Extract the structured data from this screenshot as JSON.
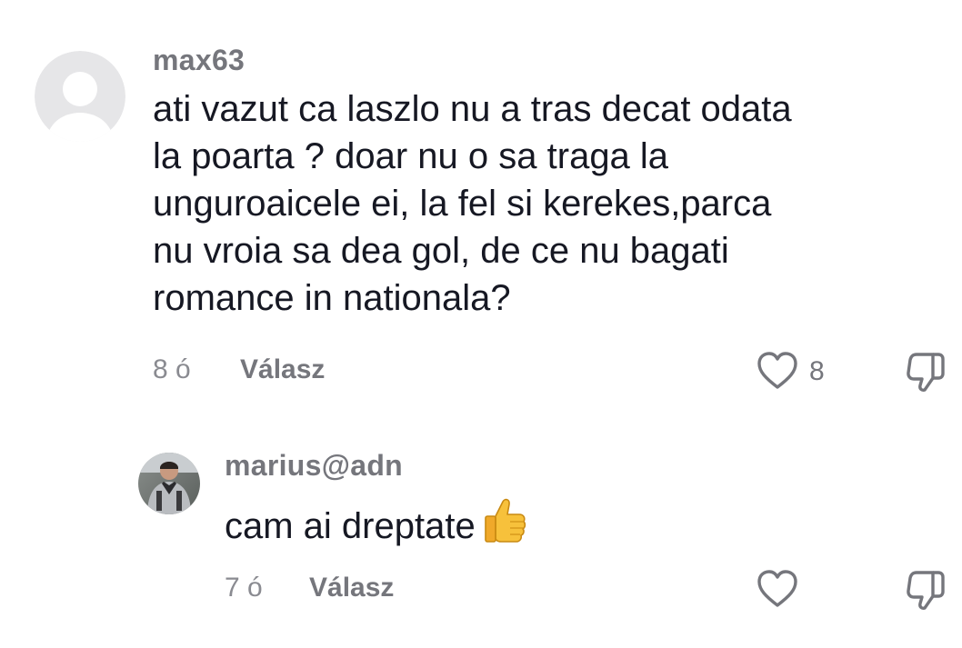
{
  "comments": [
    {
      "username": "max63",
      "text": "ati vazut ca laszlo nu a tras decat odata la poarta ? doar nu o sa traga la unguroaicele ei, la fel si kerekes,parca nu vroia sa dea gol, de ce nu bagati romance in nationala?",
      "lines": [
        "ati vazut ca laszlo nu a tras decat odata",
        "la poarta ? doar nu o sa traga la",
        "unguroaicele ei, la fel si kerekes,parca",
        "nu vroia sa dea gol, de ce nu bagati",
        "romance in nationala?"
      ],
      "age": "8 ó",
      "reply_label": "Válasz",
      "like_count": "8",
      "avatar": "default-avatar-icon"
    },
    {
      "username": "marius@adn",
      "text": "cam ai dreptate",
      "emoji": "thumbs-up-emoji",
      "age": "7 ó",
      "reply_label": "Válasz",
      "like_count": "",
      "avatar": "user-photo-avatar"
    }
  ],
  "colors": {
    "text": "#161823",
    "muted": "#75767c",
    "avatar_bg": "#e6e6e8",
    "avatar_fg": "#ffffff"
  }
}
